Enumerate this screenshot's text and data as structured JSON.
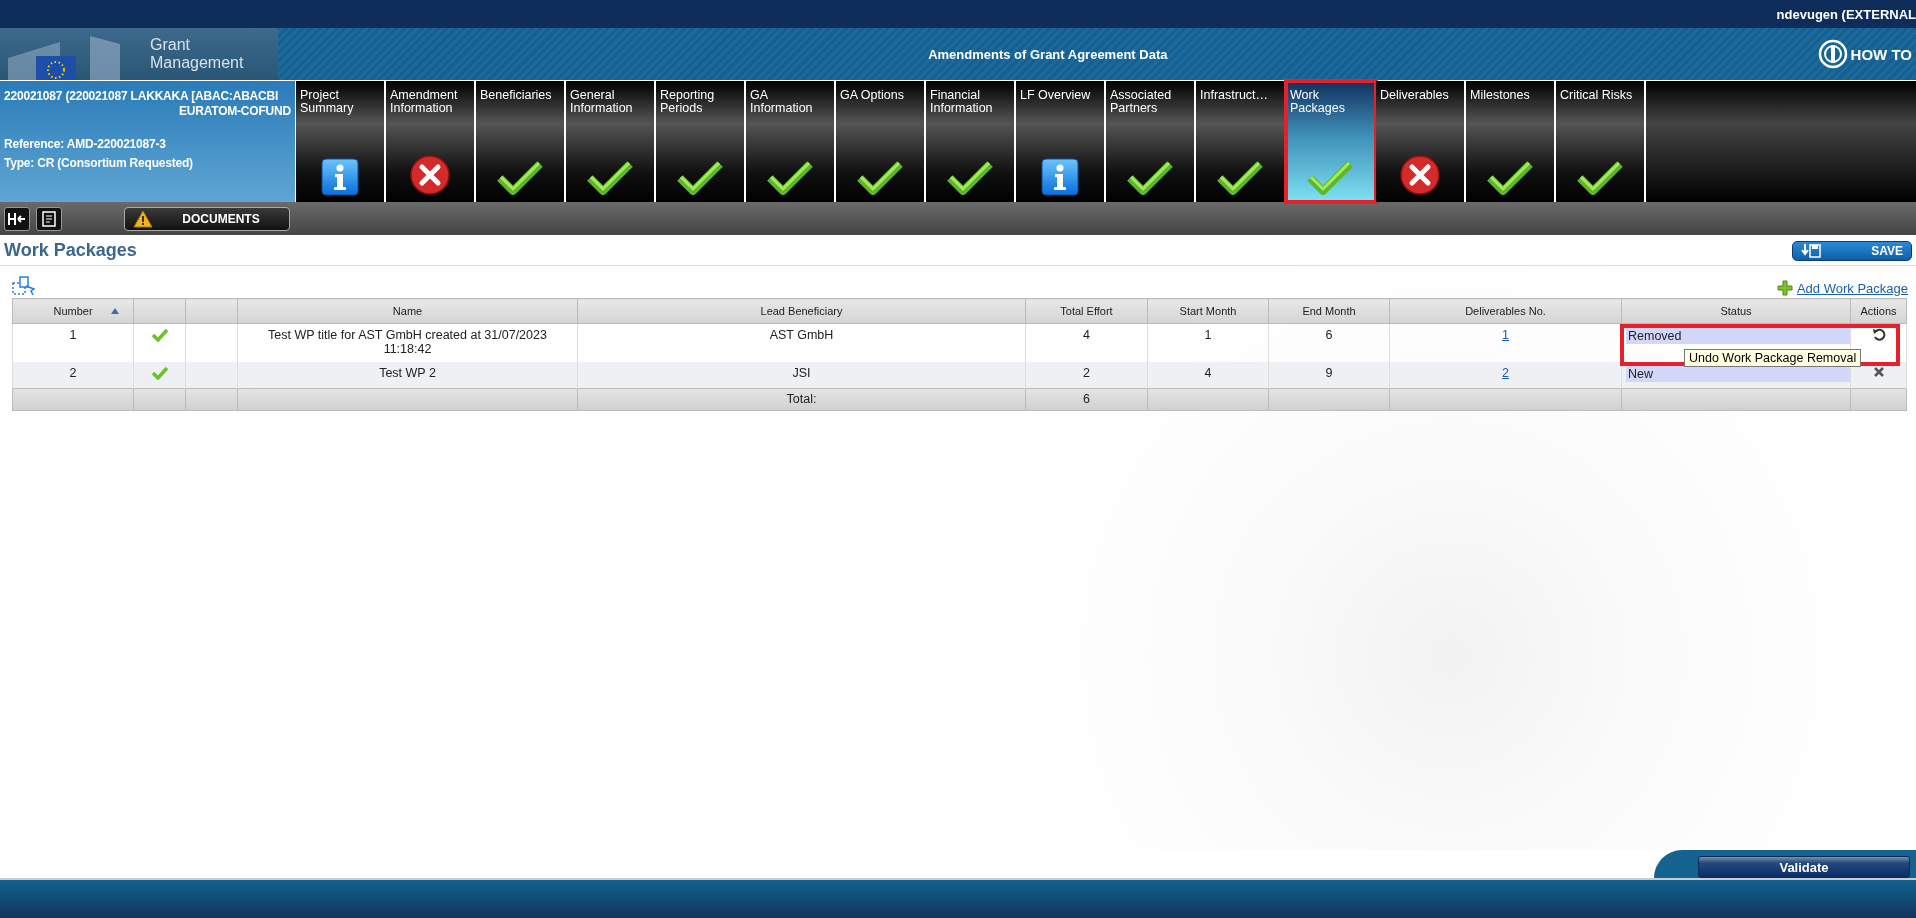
{
  "user": "ndevugen (EXTERNAL",
  "logo": {
    "line1": "Grant",
    "line2": "Management"
  },
  "page_title": "Amendments of Grant Agreement Data",
  "help_label": "HOW TO",
  "project": {
    "id_line": "220021087 (220021087 LAKKAKA [ABAC:ABACBI",
    "programme": "EURATOM-COFUND",
    "reference": "Reference: AMD-220021087-3",
    "type": "Type: CR (Consortium Requested)"
  },
  "tabs": [
    {
      "label": "Project Summary",
      "kind": "info",
      "selected": false,
      "highlighted": false
    },
    {
      "label": "Amendment Information",
      "kind": "error",
      "selected": false,
      "highlighted": false
    },
    {
      "label": "Beneficiaries",
      "kind": "ok",
      "selected": false,
      "highlighted": false
    },
    {
      "label": "General Information",
      "kind": "ok",
      "selected": false,
      "highlighted": false
    },
    {
      "label": "Reporting Periods",
      "kind": "ok",
      "selected": false,
      "highlighted": false
    },
    {
      "label": "GA Information",
      "kind": "ok",
      "selected": false,
      "highlighted": false
    },
    {
      "label": "GA Options",
      "kind": "ok",
      "selected": false,
      "highlighted": false
    },
    {
      "label": "Financial Information",
      "kind": "ok",
      "selected": false,
      "highlighted": false
    },
    {
      "label": "LF Overview",
      "kind": "info",
      "selected": false,
      "highlighted": false
    },
    {
      "label": "Associated Partners",
      "kind": "ok",
      "selected": false,
      "highlighted": false
    },
    {
      "label": "Infrastruct…",
      "kind": "ok",
      "selected": false,
      "highlighted": false
    },
    {
      "label": "Work Packages",
      "kind": "ok",
      "selected": true,
      "highlighted": true
    },
    {
      "label": "Deliverables",
      "kind": "error",
      "selected": false,
      "highlighted": false
    },
    {
      "label": "Milestones",
      "kind": "ok",
      "selected": false,
      "highlighted": false
    },
    {
      "label": "Critical Risks",
      "kind": "ok",
      "selected": false,
      "highlighted": false
    }
  ],
  "toolbar": {
    "documents_label": "DOCUMENTS",
    "documents_warning": true
  },
  "section_title": "Work Packages",
  "save_label": "SAVE",
  "add_link": "Add Work Package",
  "table": {
    "columns": [
      {
        "label": "Number",
        "sorted_ascending": true
      },
      {
        "label": "Name"
      },
      {
        "label": "Lead Beneficiary"
      },
      {
        "label": "Total Effort"
      },
      {
        "label": "Start Month"
      },
      {
        "label": "End Month"
      },
      {
        "label": "Deliverables No."
      },
      {
        "label": "Status"
      },
      {
        "label": "Actions"
      }
    ],
    "rows": [
      {
        "number": "1",
        "valid": true,
        "name": "Test WP title for AST GmbH created at 31/07/2023 11:18:42",
        "lead": "AST GmbH",
        "effort": "4",
        "start": "1",
        "end": "6",
        "deliverables": "1",
        "status": "Removed",
        "kind": "undo",
        "tooltip": "Undo Work Package Removal",
        "highlighted": true
      },
      {
        "number": "2",
        "valid": true,
        "name": "Test WP 2",
        "lead": "JSI",
        "effort": "2",
        "start": "4",
        "end": "9",
        "deliverables": "2",
        "status": "New",
        "kind": "remove",
        "highlighted": false
      }
    ],
    "totals": {
      "label": "Total:",
      "effort": "6"
    }
  },
  "validate_label": "Validate"
}
